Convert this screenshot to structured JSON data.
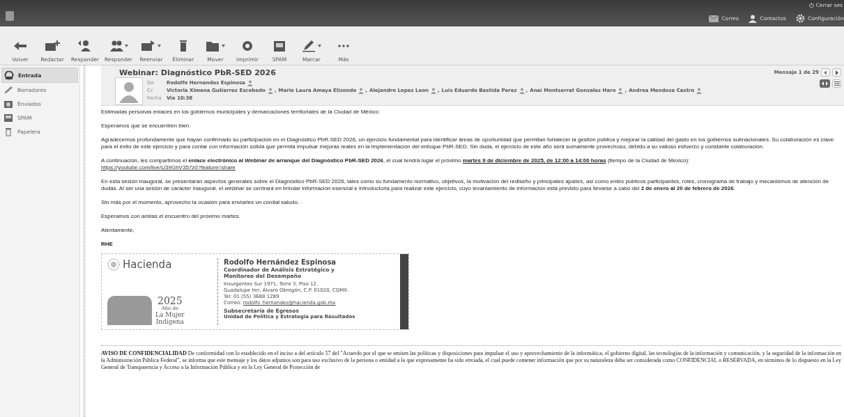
{
  "top_bar": {
    "nav": [
      {
        "label": "Correo",
        "kind": "mail"
      },
      {
        "label": "Contactos",
        "kind": "person"
      },
      {
        "label": "Configuración",
        "kind": "gear"
      }
    ],
    "logout": "Cerrar ses"
  },
  "toolbar": [
    {
      "label": "Volver",
      "kind": "back",
      "has_menu": false
    },
    {
      "label": "Redactar",
      "kind": "compose",
      "has_menu": false
    },
    {
      "label": "Responder",
      "kind": "reply",
      "has_menu": false
    },
    {
      "label": "Responder",
      "kind": "reply-all",
      "has_menu": true
    },
    {
      "label": "Reenviar",
      "kind": "forward",
      "has_menu": true
    },
    {
      "label": "Eliminar",
      "kind": "trash",
      "has_menu": false
    },
    {
      "label": "Mover",
      "kind": "folder",
      "has_menu": true
    },
    {
      "label": "Imprimir",
      "kind": "print",
      "has_menu": false
    },
    {
      "label": "SPAM",
      "kind": "spam",
      "has_menu": false
    },
    {
      "label": "Marcar",
      "kind": "pen",
      "has_menu": true
    },
    {
      "label": "Más",
      "kind": "more",
      "has_menu": false
    }
  ],
  "sidebar": {
    "items": [
      {
        "label": "Entrada",
        "kind": "inbox",
        "selected": true
      },
      {
        "label": "Borradores",
        "kind": "pen",
        "selected": false
      },
      {
        "label": "Enviados",
        "kind": "sent",
        "selected": false
      },
      {
        "label": "SPAM",
        "kind": "spam",
        "selected": false
      },
      {
        "label": "Papelera",
        "kind": "trash",
        "selected": false
      }
    ]
  },
  "message": {
    "subject": "Webinar: Diagnóstico PbR-SED 2026",
    "position": "Mensaje 1 de 29",
    "fields": [
      {
        "label": "De",
        "values": [
          "Rodolfo Hernandez Espinosa"
        ]
      },
      {
        "label": "Cc",
        "values": [
          "Victoria Ximena Gutierrez Escobedo",
          ",",
          "Mario Laura Amaya Elizondo",
          ",",
          "Alejandro Lopez Leon",
          ",",
          "Luis Eduardo Bastida Perez",
          ",",
          "Anaí Montserrat Gonzalez Haro",
          ",",
          "Andrea Mendoza Castro"
        ]
      },
      {
        "label": "Fecha",
        "values": [
          "Vie 10:38"
        ]
      }
    ],
    "paragraphs": [
      {
        "segments": [
          {
            "text": "Estimadas personas enlaces en los gobiernos municipales y demarcaciones territoriales de la Ciudad de México:",
            "underlined": false
          }
        ]
      },
      {
        "segments": [
          {
            "text": "Esperamos que se encuentren bien.",
            "underlined": false
          }
        ]
      },
      {
        "segments": [
          {
            "text": "Agradecemos profundamente que hayan confirmado su participación en el Diagnóstico PbR-SED 2026, un ejercicio fundamental para identificar áreas de oportunidad que permitan fortalecer la gestión pública y mejorar la calidad del gasto en los gobiernos subnacionales. Su colaboración es clave para el éxito de este ejercicio y para contar con información sólida que permita impulsar mejoras reales en la implementación del enfoque PbR-SED. Sin duda, el ejercicio de este año será sumamente provechoso, debido a su valioso esfuerzo y constante colaboración.",
            "underlined": false
          }
        ]
      },
      {
        "segments": [
          {
            "text": "A continuación, les compartimos el **enlace electrónico al *Webinar* de arranque del Diagnóstico PbR-SED 2026**, el cual tendrá lugar el próximo ",
            "underlined": false
          },
          {
            "text": "**martes 9 de diciembre de 2025, de 12:00 a 14:00 horas**",
            "underlined": true
          },
          {
            "text": " (tiempo de la Ciudad de México):",
            "underlined": false
          }
        ],
        "link": "https://youtube.com/live/U39GhV357z0?feature=share"
      },
      {
        "segments": [
          {
            "text": "En esta sesión inaugural, se presentarán aspectos generales sobre el Diagnóstico PbR-SED 2026, tales como su fundamento normativo, objetivos, la motivación del rediseño y principales ajustes, así como entes públicos participantes, roles, cronograma de trabajo y mecanismos de atención de dudas. Al ser una sesión de carácter inaugural, el *webinar* se centrará en brindar información esencial e introductoria para realizar este ejercicio, cuyo levantamiento de información está previsto para llevarse a cabo del **2 de enero al 20 de febrero de 2026**.",
            "underlined": false
          }
        ]
      },
      {
        "segments": [
          {
            "text": "Sin más por el momento, aprovecho la ocasión para enviarles un cordial saludo.",
            "underlined": false
          }
        ]
      },
      {
        "segments": [
          {
            "text": "Esperamos con ansias el encuentro del próximo martes.",
            "underlined": false
          }
        ]
      },
      {
        "segments": [
          {
            "text": "Atentamente,",
            "underlined": false
          }
        ]
      },
      {
        "segments": [
          {
            "text": "**RHE**",
            "underlined": false
          }
        ]
      }
    ],
    "signature": {
      "logo": "Hacienda",
      "year": "2025",
      "year_caption": "Año de",
      "motto": [
        "La Mujer",
        "Indígena"
      ],
      "name": "Rodolfo Hernández Espinosa",
      "title": "Coordinador de Análisis Estratégico y Monitoreo del Desempeño",
      "address": [
        "Insurgentes Sur 1971, Torre 3, Piso 12,",
        "Guadalupe Inn, Álvaro Obregón, C.P. 01020, CDMX.",
        "Tel: 01 (55) 3688 1289"
      ],
      "email_label": "Correo:",
      "email": "rodolfo_hernandez@hacienda.gob.mx",
      "office": "Subsecretaría de Egresos",
      "unit": "Unidad de Política y Estrategia para Resultados"
    },
    "disclaimer": "**AVISO DE CONFIDENCIALIDAD** De conformidad con lo establecido en el inciso a del artículo 57 del \"Acuerdo por el que se emiten las políticas y disposiciones para impulsar el uso y aprovechamiento de la informática, el gobierno digital, las tecnologías de la información y comunicación, y la seguridad de la información en la Administración Pública Federal\", se informa que este mensaje y los datos adjuntos son para uso exclusivo de la persona o entidad a la que expresamente ha sido enviada, el cual puede contener información que por su naturaleza deba ser considerada como CONFIDENCIAL o RESERVADA, en términos de lo dispuesto en la Ley General de Transparencia y Acceso a la Información Pública y en la Ley General de Protección de"
  }
}
